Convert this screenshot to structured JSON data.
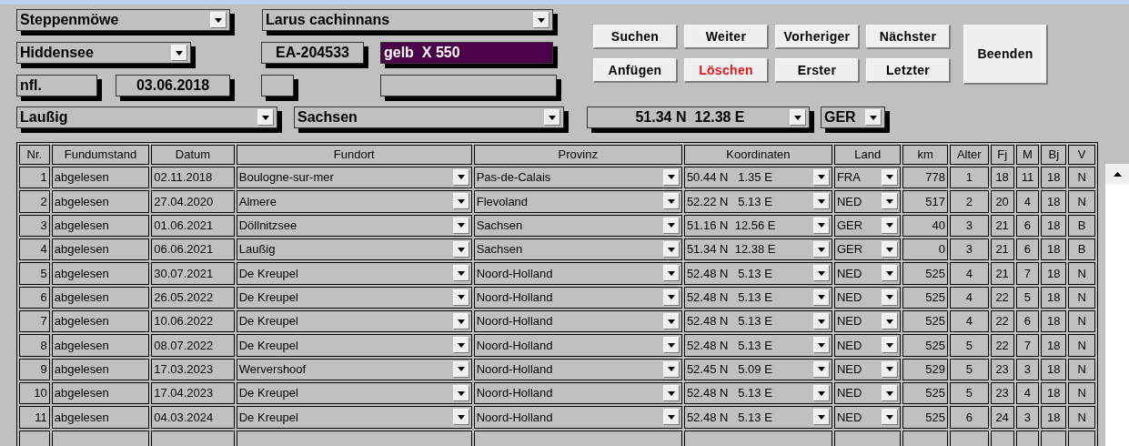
{
  "header": {
    "species": "Steppenmöwe",
    "latin_name": "Larus cachinnans",
    "station": "Hiddensee",
    "ring_number": "EA-204533",
    "color_ring": "gelb  X 550",
    "age": "nfl.",
    "ringing_date": "03.06.2018",
    "place": "Laußig",
    "province": "Sachsen",
    "coordinates": "51.34 N  12.38 E",
    "country": "GER"
  },
  "button_rows": [
    [
      {
        "label": "Suchen",
        "kind": "normal"
      },
      {
        "label": "Weiter",
        "kind": "normal"
      },
      {
        "label": "Vorheriger",
        "kind": "normal"
      },
      {
        "label": "Nächster",
        "kind": "normal"
      }
    ],
    [
      {
        "label": "Anfügen",
        "kind": "normal"
      },
      {
        "label": "Löschen",
        "kind": "danger"
      },
      {
        "label": "Erster",
        "kind": "normal"
      },
      {
        "label": "Letzter",
        "kind": "normal"
      }
    ]
  ],
  "exit_button": "Beenden",
  "table": {
    "columns": [
      {
        "label": "Nr.",
        "kind": "number"
      },
      {
        "label": "Fundumstand",
        "kind": "text"
      },
      {
        "label": "Datum",
        "kind": "text"
      },
      {
        "label": "Fundort",
        "kind": "dropdown"
      },
      {
        "label": "Provinz",
        "kind": "dropdown"
      },
      {
        "label": "Koordinaten",
        "kind": "dropdown"
      },
      {
        "label": "Land",
        "kind": "dropdown"
      },
      {
        "label": "km",
        "kind": "number"
      },
      {
        "label": "Alter",
        "kind": "center"
      },
      {
        "label": "Fj",
        "kind": "center"
      },
      {
        "label": "M",
        "kind": "center"
      },
      {
        "label": "Bj",
        "kind": "center"
      },
      {
        "label": "V",
        "kind": "center"
      }
    ],
    "rows": [
      [
        "1",
        "abgelesen",
        "02.11.2018",
        "Boulogne-sur-mer",
        "Pas-de-Calais",
        "50.44 N   1.35 E",
        "FRA",
        "778",
        "1",
        "18",
        "11",
        "18",
        "N"
      ],
      [
        "2",
        "abgelesen",
        "27.04.2020",
        "Almere",
        "Flevoland",
        "52.22 N   5.13 E",
        "NED",
        "517",
        "2",
        "20",
        "4",
        "18",
        "N"
      ],
      [
        "3",
        "abgelesen",
        "01.06.2021",
        "Döllnitzsee",
        "Sachsen",
        "51.16 N  12.56 E",
        "GER",
        "40",
        "3",
        "21",
        "6",
        "18",
        "B"
      ],
      [
        "4",
        "abgelesen",
        "06.06.2021",
        "Laußig",
        "Sachsen",
        "51.34 N  12.38 E",
        "GER",
        "0",
        "3",
        "21",
        "6",
        "18",
        "B"
      ],
      [
        "5",
        "abgelesen",
        "30.07.2021",
        "De Kreupel",
        "Noord-Holland",
        "52.48 N   5.13 E",
        "NED",
        "525",
        "4",
        "21",
        "7",
        "18",
        "N"
      ],
      [
        "6",
        "abgelesen",
        "26.05.2022",
        "De Kreupel",
        "Noord-Holland",
        "52.48 N   5.13 E",
        "NED",
        "525",
        "4",
        "22",
        "5",
        "18",
        "N"
      ],
      [
        "7",
        "abgelesen",
        "10.06.2022",
        "De Kreupel",
        "Noord-Holland",
        "52.48 N   5.13 E",
        "NED",
        "525",
        "4",
        "22",
        "6",
        "18",
        "N"
      ],
      [
        "8",
        "abgelesen",
        "08.07.2022",
        "De Kreupel",
        "Noord-Holland",
        "52.48 N   5.13 E",
        "NED",
        "525",
        "5",
        "22",
        "7",
        "18",
        "N"
      ],
      [
        "9",
        "abgelesen",
        "17.03.2023",
        "Wervershoof",
        "Noord-Holland",
        "52.45 N   5.09 E",
        "NED",
        "529",
        "5",
        "23",
        "3",
        "18",
        "N"
      ],
      [
        "10",
        "abgelesen",
        "17.04.2023",
        "De Kreupel",
        "Noord-Holland",
        "52.48 N   5.13 E",
        "NED",
        "525",
        "5",
        "23",
        "4",
        "18",
        "N"
      ],
      [
        "11",
        "abgelesen",
        "04.03.2024",
        "De Kreupel",
        "Noord-Holland",
        "52.48 N   5.13 E",
        "NED",
        "525",
        "6",
        "24",
        "3",
        "18",
        "N"
      ]
    ]
  }
}
